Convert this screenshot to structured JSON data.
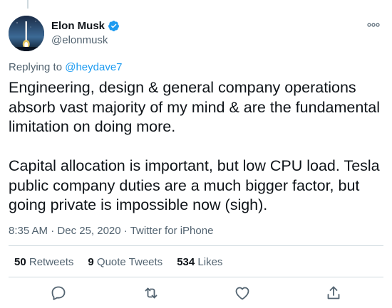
{
  "tweet": {
    "author": {
      "display_name": "Elon Musk",
      "handle": "@elonmusk",
      "verified": true
    },
    "reply_prefix": "Replying to ",
    "reply_to": "@heydave7",
    "text": "Engineering, design & general company operations\nabsorb vast majority of my mind & are the fundamental\nlimitation on doing more.\n\nCapital allocation is important, but low CPU load. Tesla\npublic company duties are a much bigger factor, but\ngoing private is impossible now (sigh).",
    "time": "8:35 AM",
    "separator": " · ",
    "date": "Dec 25, 2020",
    "source": "Twitter for iPhone"
  },
  "stats": {
    "retweets": {
      "count": "50",
      "label": "Retweets"
    },
    "quote_tweets": {
      "count": "9",
      "label": "Quote Tweets"
    },
    "likes": {
      "count": "534",
      "label": "Likes"
    }
  },
  "colors": {
    "accent": "#1d9bf0",
    "secondary_text": "#536471",
    "primary_text": "#0f1419",
    "divider": "#cfd9de"
  },
  "icons": {
    "verified": "verified-badge-icon",
    "more": "more-icon",
    "reply": "reply-icon",
    "retweet": "retweet-icon",
    "like": "heart-icon",
    "share": "share-icon"
  }
}
